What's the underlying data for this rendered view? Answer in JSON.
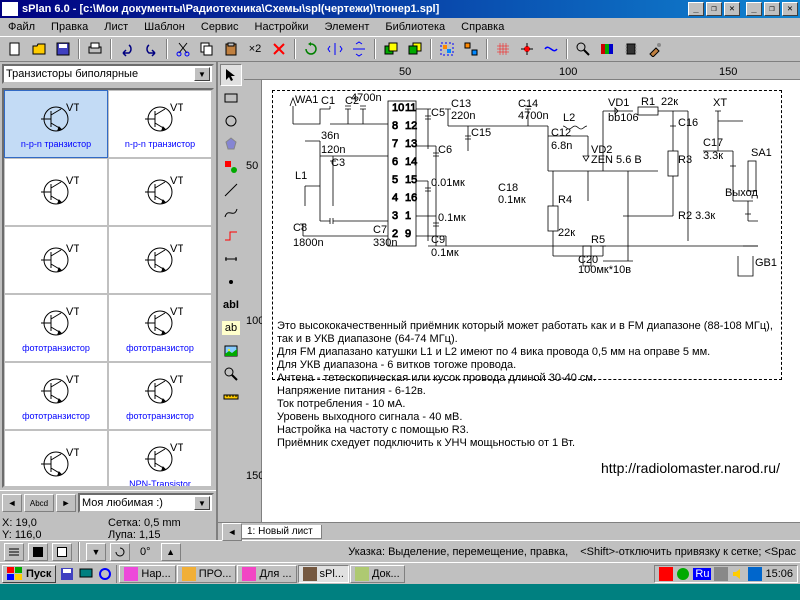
{
  "title": "sPlan 6.0 - [c:\\Мои документы\\Радиотехника\\Схемы\\spl(чертежи)\\тюнер1.spl]",
  "menu": [
    "Файл",
    "Правка",
    "Лист",
    "Шаблон",
    "Сервис",
    "Настройки",
    "Элемент",
    "Библиотека",
    "Справка"
  ],
  "toolbar_zoom": "×2",
  "palette_combo": "Транзисторы биполярные",
  "palette": [
    {
      "label": "n-p-n транзистор",
      "sel": true
    },
    {
      "label": "n-p-n транзистор"
    },
    {
      "label": ""
    },
    {
      "label": ""
    },
    {
      "label": ""
    },
    {
      "label": ""
    },
    {
      "label": "фототранзистор"
    },
    {
      "label": "фототранзистор"
    },
    {
      "label": "фототранзистор"
    },
    {
      "label": "фототранзистор"
    },
    {
      "label": ""
    },
    {
      "label": "NPN-Transistor"
    },
    {
      "label": ""
    },
    {
      "label": ""
    }
  ],
  "fav_combo": "Моя любимая :)",
  "coords": {
    "x": "X: 19,0",
    "y": "Y: 116,0",
    "grid": "Сетка:  0,5 mm",
    "zoom": "Лупа:   1,15"
  },
  "ruler_h": [
    "50",
    "100",
    "150"
  ],
  "ruler_v": [
    "50",
    "100",
    "150"
  ],
  "sheet_tab": "1: Новый лист",
  "schematic_text": [
    "Это высококачественный приёмник который может работать как и в FM диапазоне (88-108 МГц),",
    "так и в УКВ диапазоне (64-74 МГц).",
    "Для FM диапазано катушки L1 и  L2 имеют по 4 вика провода 0,5 мм на оправе 5 мм.",
    "Для УКВ диапазона - 6 витков тогоже провода.",
    "Антена - тетескопическая или кусок провода длиной 30-40 см.",
    "Напряжение питания - 6-12в.",
    "Ток потребления - 10 мА.",
    "Уровень выходного сигнала - 40 мВ.",
    "Настройка на частоту с помощью R3.",
    "Приёмник схедует подключить к УНЧ мощьностью от 1 Вт."
  ],
  "schematic_url": "http://radiolomaster.narod.ru/",
  "schematic_labels": {
    "wa1": "WA1",
    "c1": "C1",
    "c2": "C2",
    "c3": "C3",
    "c4": "4700n",
    "c5": "36n",
    "c6": "120n",
    "c8": "C8",
    "c8v": "1800n",
    "c7": "C7",
    "c7v": "330n",
    "c9": "C9",
    "c9v": "0.1мк",
    "c10": "0.01мк",
    "c11": "0.1мк",
    "c12": "C12",
    "c12v": "6.8n",
    "c13": "C13",
    "c13v": "220n",
    "c14": "C14",
    "c14v": "4700n",
    "c15": "C15",
    "c15v": "0.1мк",
    "c16": "C16",
    "c17": "C17",
    "c17v": "3.3к",
    "c18": "C18",
    "c18v": "0.1мк",
    "c19": "0.1мк",
    "c20": "C20",
    "c20v": "100мк*10в",
    "vd1": "VD1",
    "vd1t": "bb106",
    "vd2": "VD2",
    "vd2t": "ZEN 5.6 В",
    "r1": "R1",
    "r1v": "22к",
    "r2": "R2",
    "r2v": "R2 3.3к",
    "r3": "R3",
    "r4": "R4",
    "r4v": "22к",
    "r5": "R5",
    "l1": "L1",
    "l2": "L2",
    "sa1": "SA1",
    "gb1": "GB1",
    "xt": "XT",
    "out": "Выход",
    "pins": [
      "10",
      "11",
      "8",
      "12",
      "7",
      "13",
      "6",
      "14",
      "5",
      "15",
      "4",
      "16",
      "3",
      "1",
      "2",
      "9"
    ]
  },
  "bottom_angle": "0°",
  "status_hint": "Указка: Выделение, перемещение, правка,",
  "status_hint2": "<Shift>-отключить привязку к сетке; <Spac",
  "taskbar": {
    "start": "Пуск",
    "tasks": [
      {
        "label": "Нар..."
      },
      {
        "label": "ПРО..."
      },
      {
        "label": "Для ..."
      },
      {
        "label": "sPl...",
        "active": true
      },
      {
        "label": "Док..."
      }
    ],
    "lang": "Ru",
    "clock": "15:06"
  }
}
